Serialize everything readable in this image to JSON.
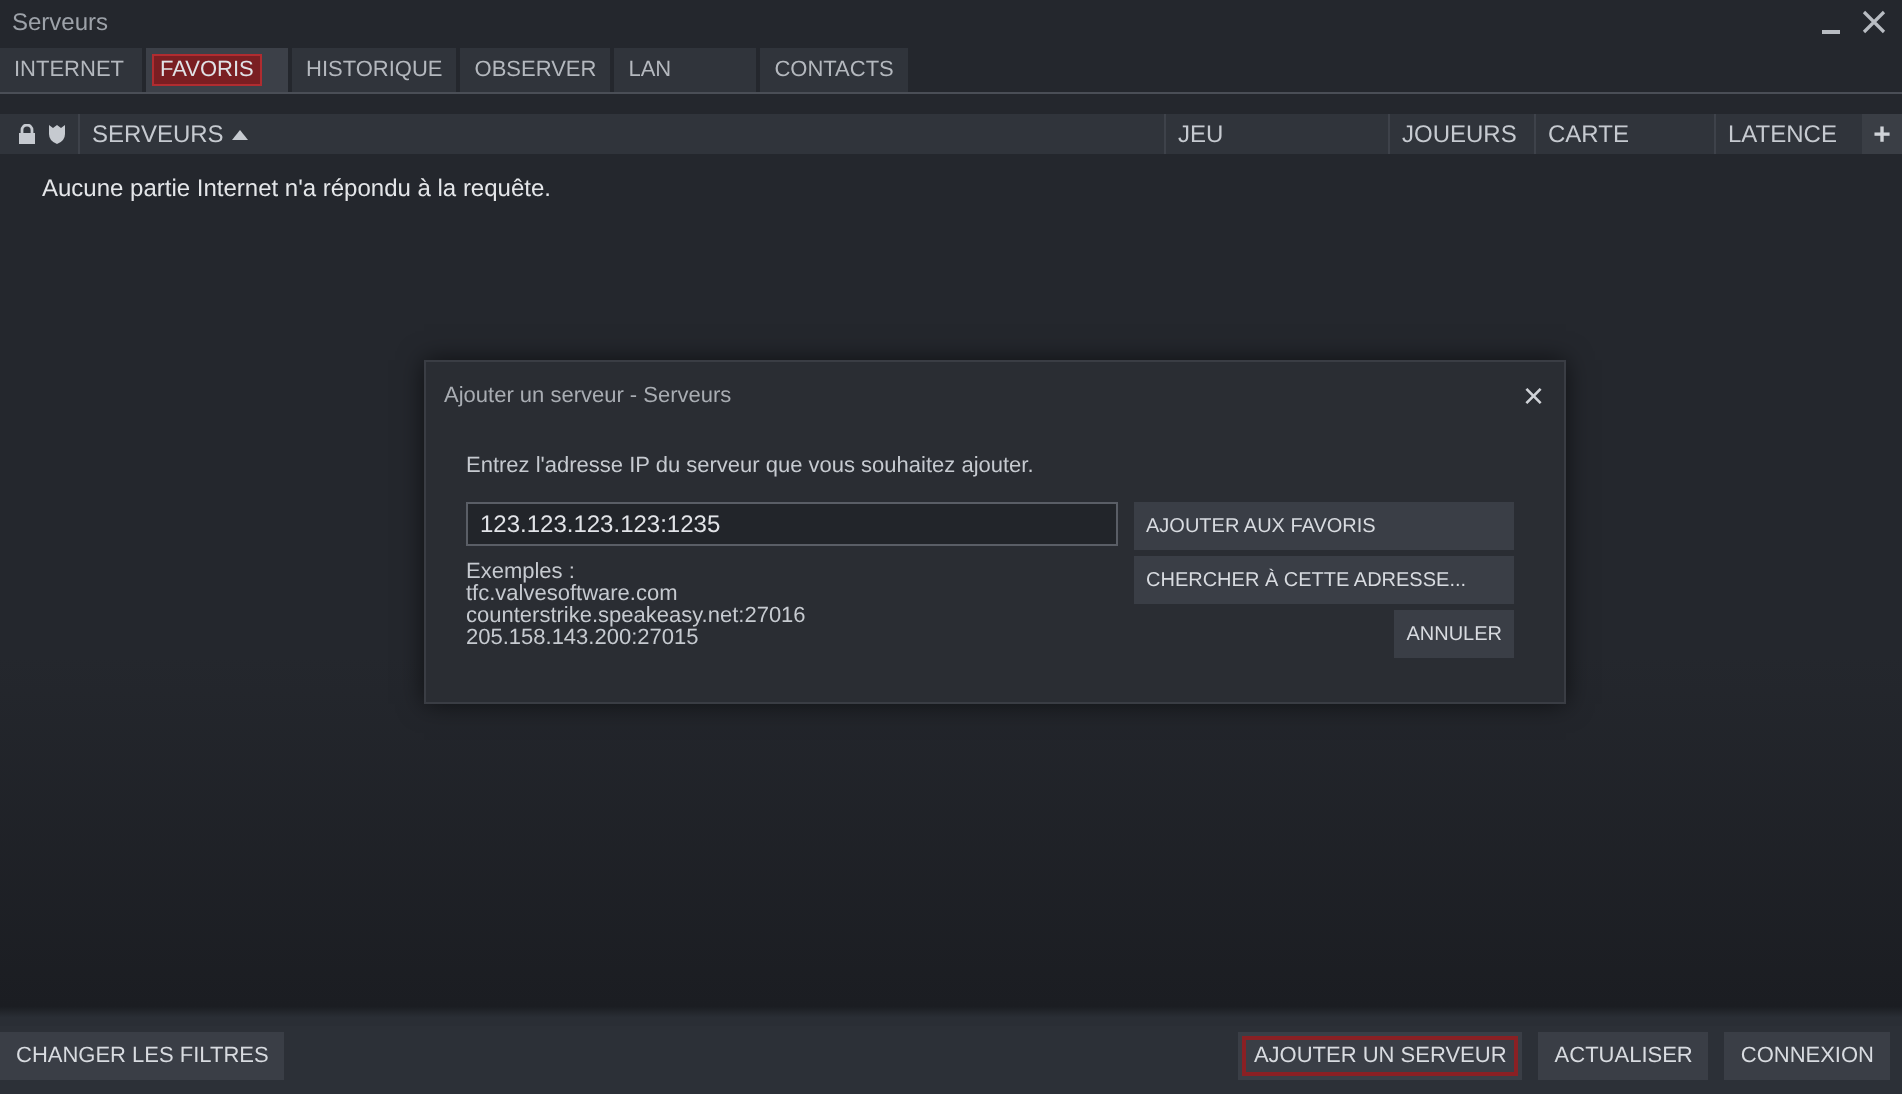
{
  "window": {
    "title": "Serveurs"
  },
  "tabs": [
    {
      "label": "INTERNET",
      "selected": false,
      "highlighted": false
    },
    {
      "label": "FAVORIS",
      "selected": true,
      "highlighted": true
    },
    {
      "label": "HISTORIQUE",
      "selected": false,
      "highlighted": false
    },
    {
      "label": "OBSERVER",
      "selected": false,
      "highlighted": false
    },
    {
      "label": "LAN",
      "selected": false,
      "highlighted": false
    },
    {
      "label": "CONTACTS",
      "selected": false,
      "highlighted": false
    }
  ],
  "table": {
    "columns": [
      {
        "label": "SERVEURS",
        "sorted": true
      },
      {
        "label": "JEU",
        "sorted": false
      },
      {
        "label": "JOUEURS",
        "sorted": false
      },
      {
        "label": "CARTE",
        "sorted": false
      },
      {
        "label": "LATENCE",
        "sorted": false
      }
    ],
    "add_column": "+",
    "message": "Aucune partie Internet n'a répondu à la requête."
  },
  "dialog": {
    "title": "Ajouter un serveur - Serveurs",
    "close": "×",
    "prompt": "Entrez l'adresse IP du serveur que vous souhaitez ajouter.",
    "address": "123.123.123.123:1235",
    "examples": [
      "Exemples :",
      "tfc.valvesoftware.com",
      "counterstrike.speakeasy.net:27016",
      "205.158.143.200:27015"
    ],
    "buttons": [
      "AJOUTER AUX FAVORIS",
      "CHERCHER À CETTE ADRESSE...",
      "ANNULER"
    ]
  },
  "footer": {
    "left_buttons": [
      {
        "label": "CHANGER LES FILTRES",
        "highlighted": false
      }
    ],
    "right_buttons": [
      {
        "label": "AJOUTER UN SERVEUR",
        "highlighted": true
      },
      {
        "label": "ACTUALISER",
        "highlighted": false
      },
      {
        "label": "CONNEXION",
        "highlighted": false
      }
    ]
  }
}
